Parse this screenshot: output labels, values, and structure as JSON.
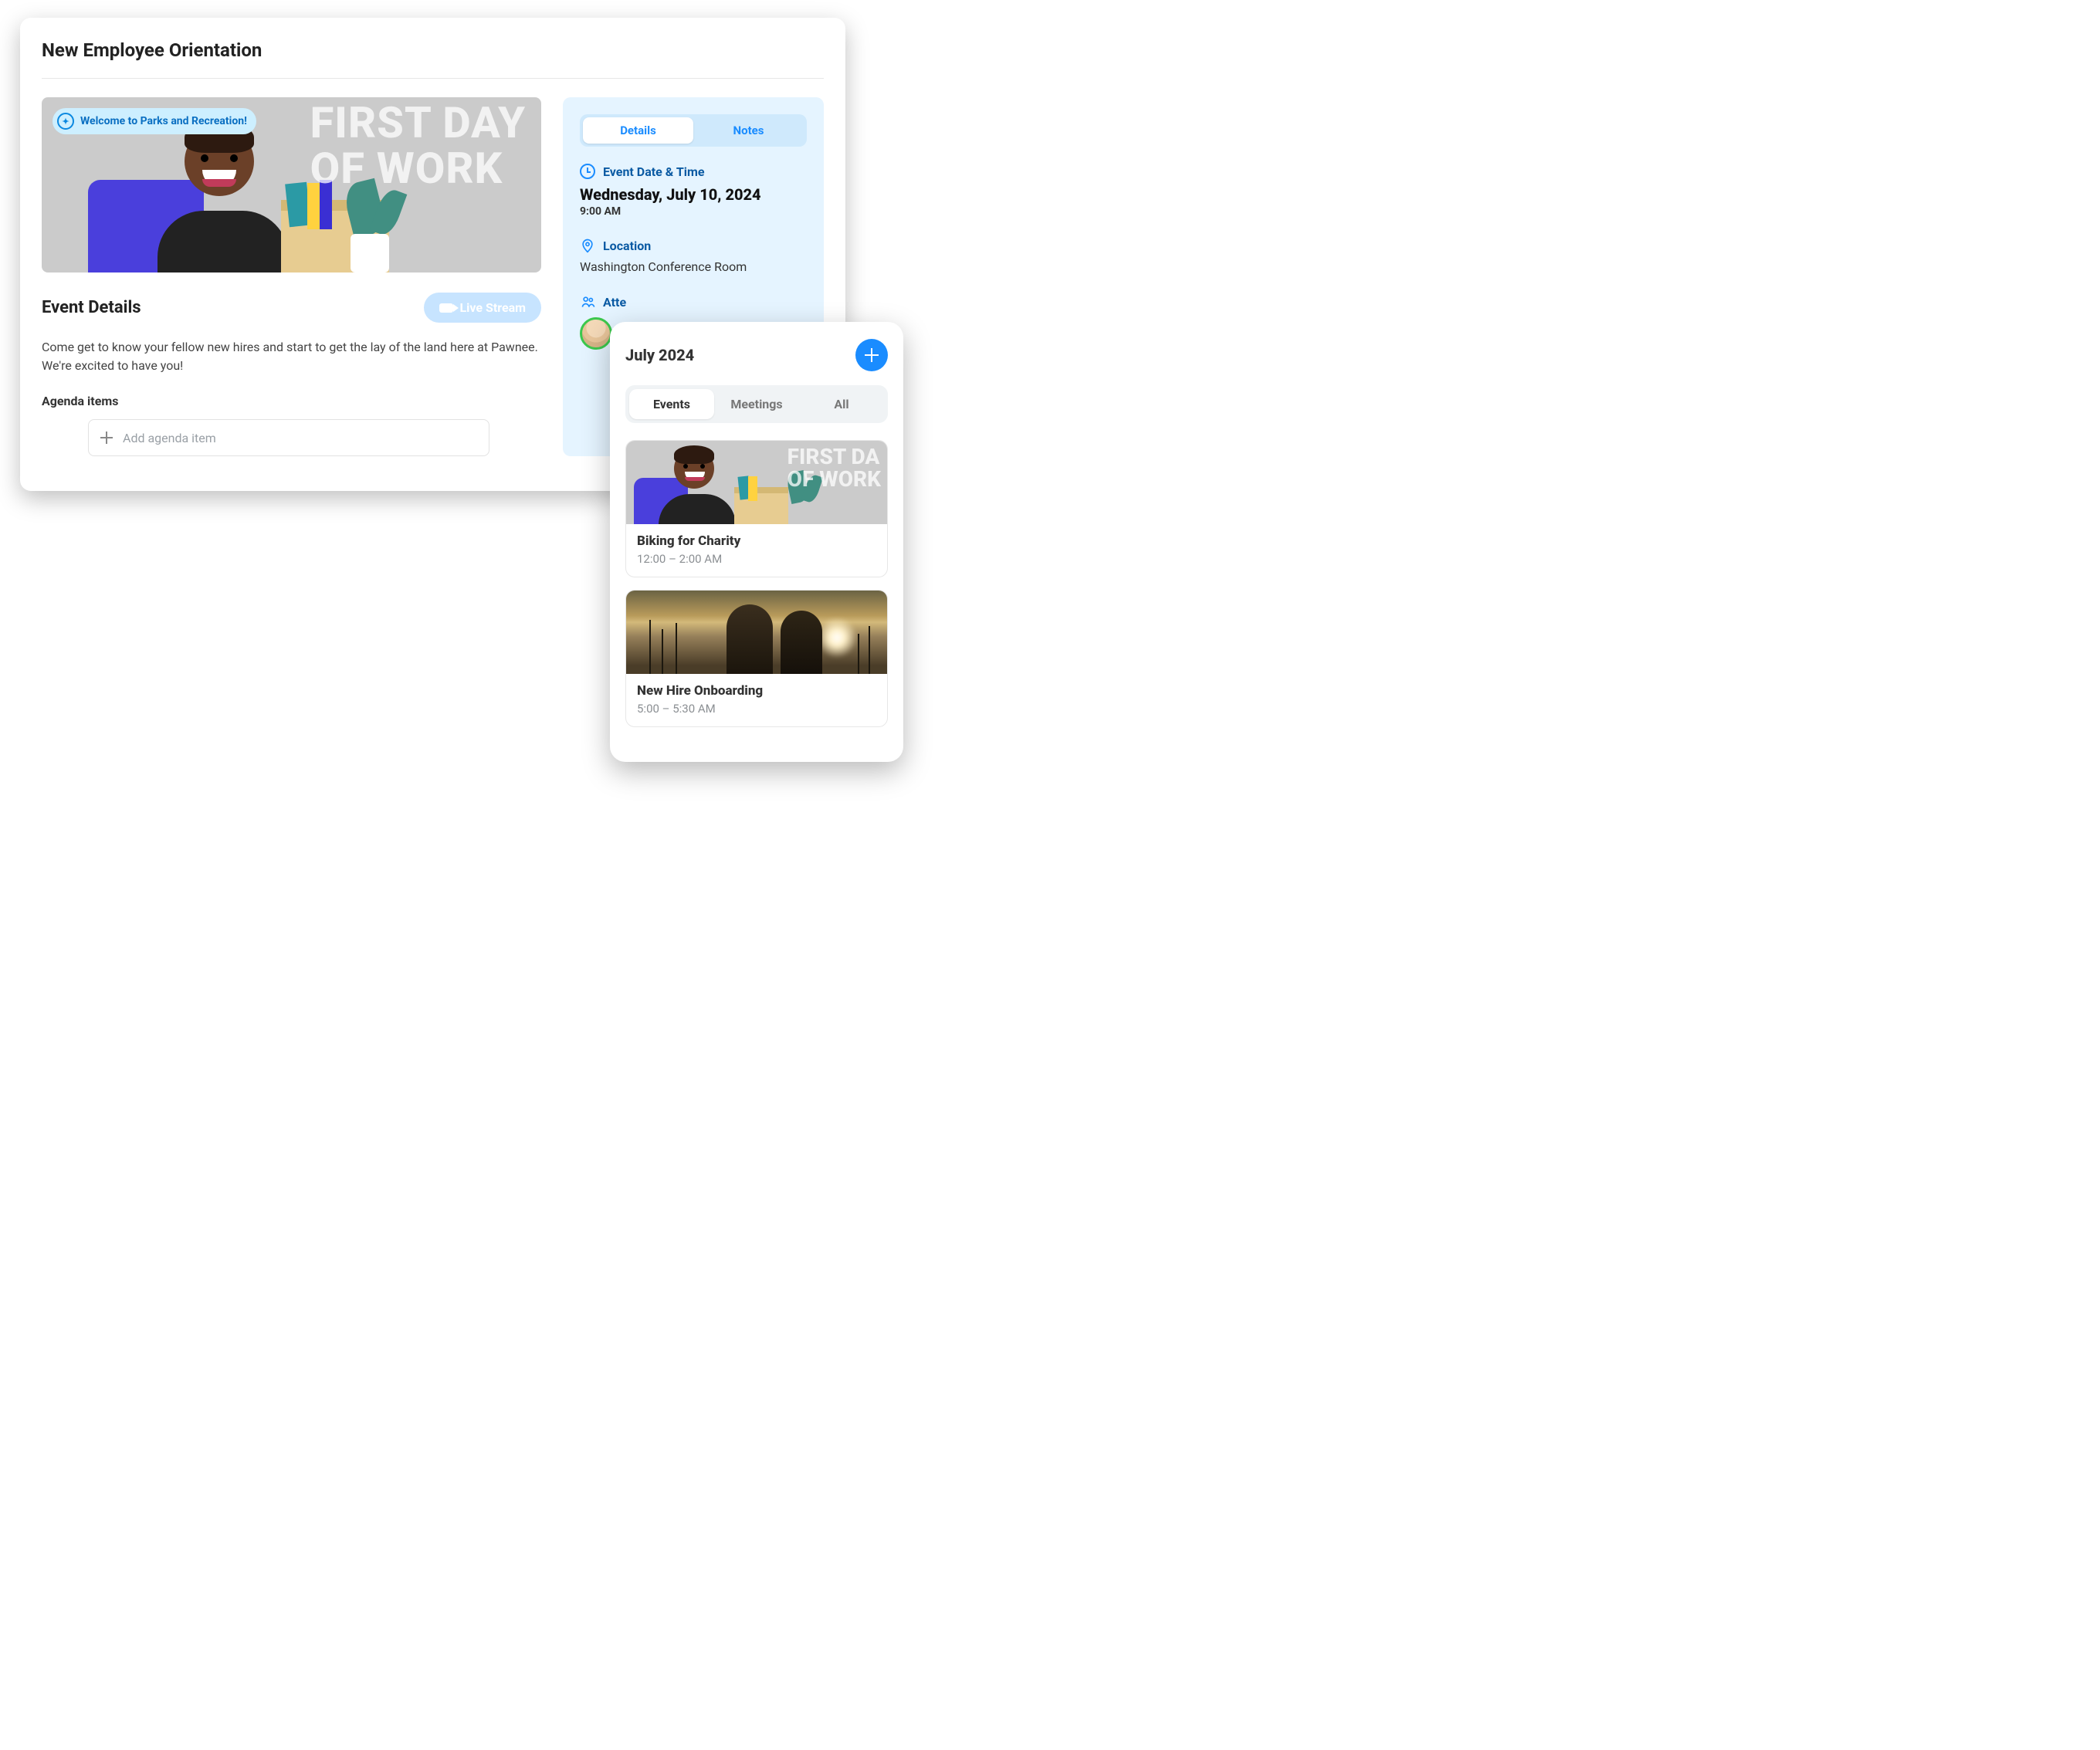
{
  "desktop": {
    "page_title": "New Employee Orientation",
    "hero": {
      "pill_text": "Welcome to Parks and Recreation!",
      "overlay_line1": "FIRST DAY",
      "overlay_line2": "OF WORK"
    },
    "details_section": {
      "title": "Event Details",
      "live_stream_label": "Live Stream",
      "description": "Come get to know your fellow new hires and start to get the lay of the land here at Pawnee. We're excited to have you!",
      "agenda_title": "Agenda items",
      "agenda_placeholder": "Add agenda item"
    },
    "right_panel": {
      "tabs": {
        "details": "Details",
        "notes": "Notes"
      },
      "datetime": {
        "label": "Event Date & Time",
        "date": "Wednesday, July 10, 2024",
        "time": "9:00 AM"
      },
      "location": {
        "label": "Location",
        "value": "Washington Conference Room"
      },
      "attendees": {
        "label_partial": "Atte"
      }
    }
  },
  "mobile": {
    "month_title": "July 2024",
    "tabs": {
      "events": "Events",
      "meetings": "Meetings",
      "all": "All"
    },
    "cards": [
      {
        "title": "Biking for Charity",
        "time": "12:00 – 2:00 AM",
        "hero_line1": "FIRST DA",
        "hero_line2": "OF WORK"
      },
      {
        "title": "New Hire Onboarding",
        "time": "5:00 – 5:30 AM"
      }
    ]
  }
}
